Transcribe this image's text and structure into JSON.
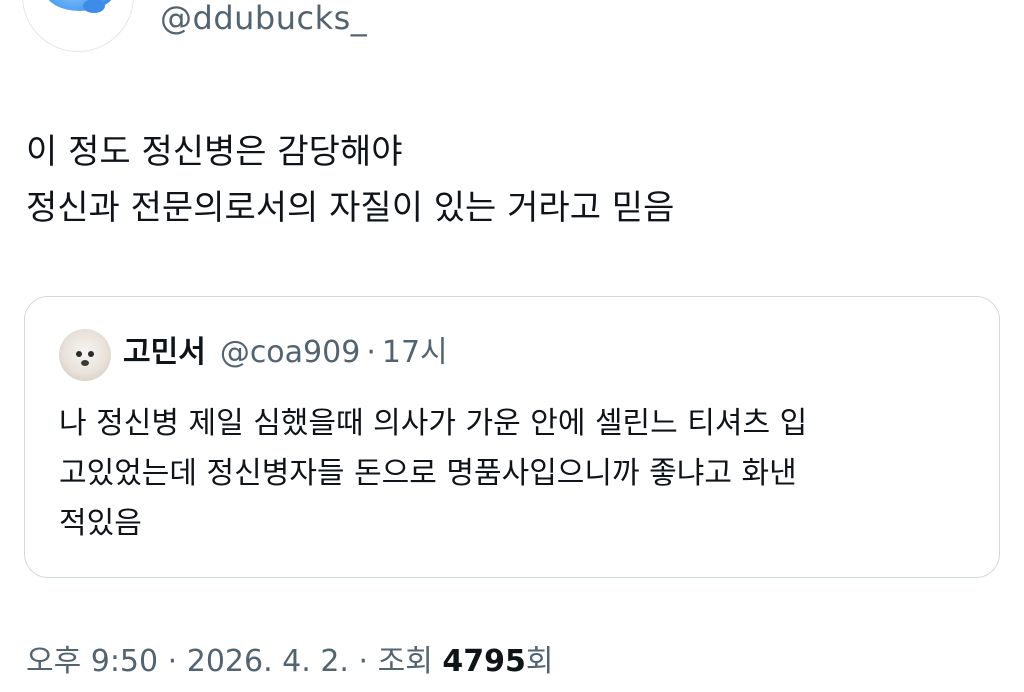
{
  "author": {
    "handle": "@ddubucks_",
    "avatar_icon": "blue-blob-avatar"
  },
  "tweet": {
    "lines": [
      "이 정도 정신병은 감당해야",
      "정신과 전문의로서의 자질이 있는 거라고 믿음"
    ]
  },
  "quote": {
    "name": "고민서",
    "handle": "@coa909",
    "separator": "·",
    "time": "17시",
    "avatar_icon": "white-dog-avatar",
    "lines": [
      "나 정신병 제일 심했을때 의사가 가운 안에 셀린느 티셔츠 입",
      "고있었는데 정신병자들 돈으로 명품사입으니까 좋냐고 화낸",
      "적있음"
    ]
  },
  "meta": {
    "time": "오후 9:50",
    "sep1": "·",
    "date": "2026. 4. 2.",
    "sep2": "·",
    "views_label": "조회",
    "views_count": "4795",
    "views_suffix": "회"
  },
  "colors": {
    "text": "#0f1419",
    "secondary": "#536471",
    "border": "#cfd9de"
  }
}
